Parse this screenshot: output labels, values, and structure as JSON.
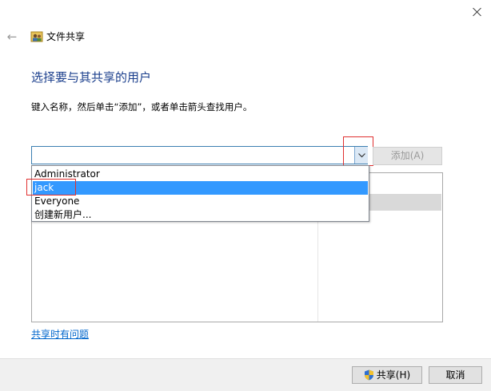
{
  "window": {
    "title": "文件共享"
  },
  "main": {
    "heading": "选择要与其共享的用户",
    "instruction": "键入名称，然后单击“添加”，或者单击箭头查找用户。",
    "combo_value": "",
    "add_button": "添加(A)",
    "dropdown_items": [
      "Administrator",
      "jack",
      "Everyone",
      "创建新用户..."
    ],
    "selected_item": "jack",
    "help_link": "共享时有问题"
  },
  "footer": {
    "share_button": "共享(H)",
    "cancel_button": "取消"
  },
  "colors": {
    "heading": "#1a3e8c",
    "selection": "#3399ff",
    "link": "#0066cc",
    "annotation_box": "#e03030"
  },
  "icons": {
    "back": "back-arrow-icon",
    "title": "users-icon",
    "combo_arrow": "chevron-down-icon",
    "share": "shield-icon",
    "close": "close-icon"
  }
}
